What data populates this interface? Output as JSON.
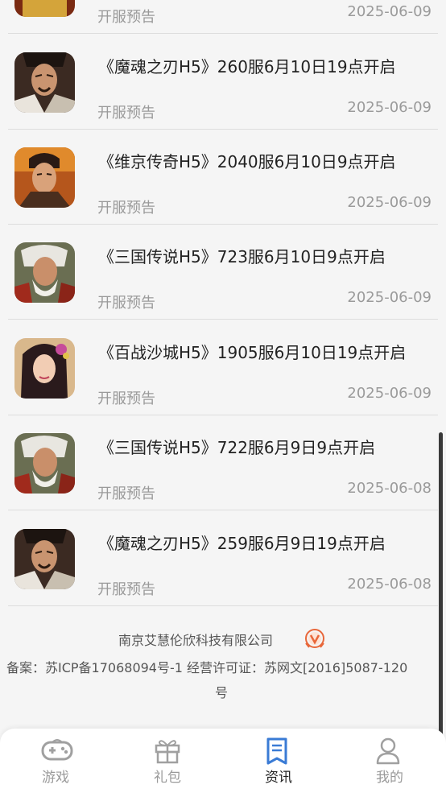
{
  "news_list": [
    {
      "title": "",
      "category": "开服预告",
      "date": "2025-06-09",
      "thumb": "warrior-red-avatar"
    },
    {
      "title": "《魔魂之刃H5》260服6月10日19点开启",
      "category": "开服预告",
      "date": "2025-06-09",
      "thumb": "warrior-dark-avatar"
    },
    {
      "title": "《维京传奇H5》2040服6月10日9点开启",
      "category": "开服预告",
      "date": "2025-06-09",
      "thumb": "young-warrior-avatar"
    },
    {
      "title": "《三国传说H5》723服6月10日9点开启",
      "category": "开服预告",
      "date": "2025-06-09",
      "thumb": "elder-warrior-avatar"
    },
    {
      "title": "《百战沙城H5》1905服6月10日19点开启",
      "category": "开服预告",
      "date": "2025-06-09",
      "thumb": "lady-avatar"
    },
    {
      "title": "《三国传说H5》722服6月9日9点开启",
      "category": "开服预告",
      "date": "2025-06-08",
      "thumb": "elder-warrior-avatar"
    },
    {
      "title": "《魔魂之刃H5》259服6月9日19点开启",
      "category": "开服预告",
      "date": "2025-06-08",
      "thumb": "warrior-dark-avatar"
    }
  ],
  "footer": {
    "company": "南京艾慧伦欣科技有限公司",
    "icp_line1": "备案：苏ICP备17068094号-1 经营许可证：苏网文[2016]5087-120",
    "icp_line2": "号"
  },
  "tabbar": {
    "tabs": [
      {
        "label": "游戏",
        "icon": "gamepad-icon"
      },
      {
        "label": "礼包",
        "icon": "gift-icon"
      },
      {
        "label": "资讯",
        "icon": "news-icon"
      },
      {
        "label": "我的",
        "icon": "user-icon"
      }
    ],
    "active_index": 2
  },
  "colors": {
    "active_tab": "#3a7bd5",
    "inactive_tab": "#a0a0a0",
    "badge": "#e8673a"
  }
}
